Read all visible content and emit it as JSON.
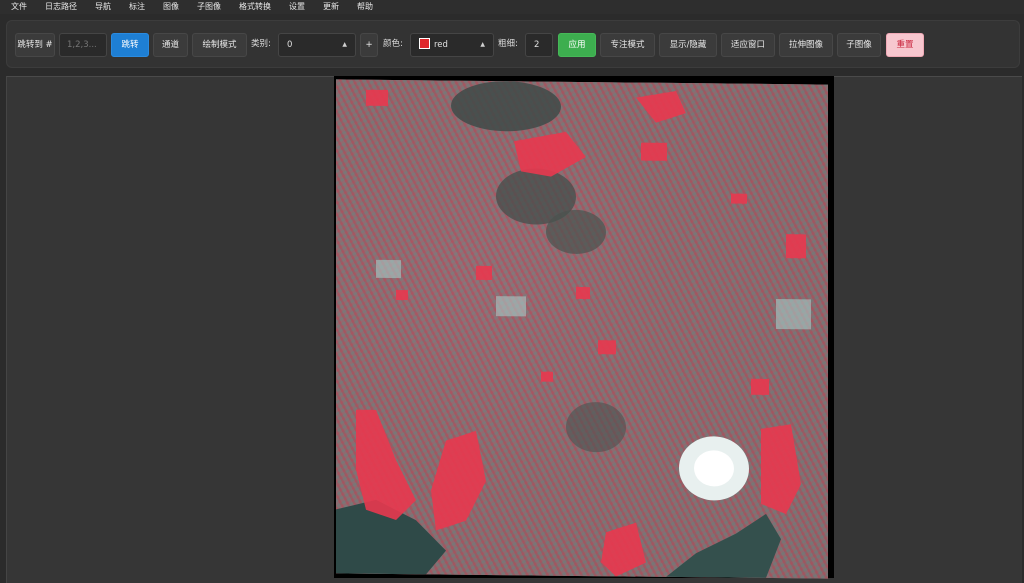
{
  "menu": [
    "文件",
    "日志路径",
    "导航",
    "标注",
    "图像",
    "子图像",
    "格式转换",
    "设置",
    "更新",
    "帮助"
  ],
  "toolbar": {
    "jump_label": "跳转到 #",
    "jump_placeholder": "1,2,3...",
    "jump_button": "跳转",
    "channel_button": "通道",
    "draw_mode_button": "绘制模式",
    "category_label": "类别:",
    "category_value": "0",
    "add_button": "+",
    "color_label": "颜色:",
    "color_value": "red",
    "thickness_label": "粗细:",
    "thickness_value": "2",
    "apply_button": "应用",
    "focus_mode_button": "专注模式",
    "show_hide_button": "显示/隐藏",
    "fit_window_button": "适应窗口",
    "stretch_image_button": "拉伸图像",
    "sub_image_button": "子图像",
    "reset_button": "重置"
  },
  "colors": {
    "accent_blue": "#1e7fd4",
    "apply_green": "#3dae4f",
    "reset_pink": "#f7c7cf",
    "swatch_red": "#e0262a"
  }
}
